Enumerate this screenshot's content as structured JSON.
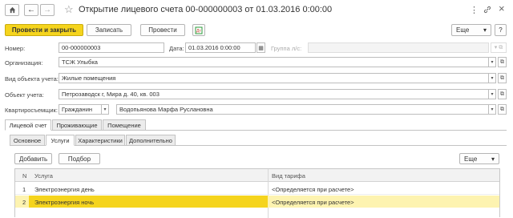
{
  "window": {
    "title": "Открытие лицевого счета 00-000000003 от 01.03.2016 0:00:00",
    "star": "☆",
    "more_icon": "⋮",
    "link_icon": "🔗",
    "close_icon": "×"
  },
  "toolbar": {
    "post_close_label": "Провести и закрыть",
    "save_label": "Записать",
    "post_label": "Провести",
    "more_label": "Еще",
    "help_label": "?",
    "dropdown_icon": "▾",
    "print_icon": "Дт"
  },
  "form": {
    "number_label": "Номер:",
    "number_value": "00-000000003",
    "date_label": "Дата:",
    "date_value": "01.03.2016  0:00:00",
    "group_label": "Группа л/с:",
    "org_label": "Организация:",
    "org_value": "ТСЖ Улыбка",
    "object_kind_label": "Вид объекта учета:",
    "object_kind_value": "Жилые помещения",
    "object_label": "Объект учета:",
    "object_value": "Петрозаводск г, Мира д. 40, кв. 003",
    "tenant_label": "Квартиросъемщик:",
    "tenant_type_value": "Гражданин",
    "tenant_value": "Водопьянова Марфа Руслановна"
  },
  "outer_tabs": [
    "Лицевой счет",
    "Проживающие",
    "Помещение"
  ],
  "inner_tabs": [
    "Основное",
    "Услуги",
    "Характеристики",
    "Дополнительно"
  ],
  "services": {
    "add_label": "Добавить",
    "pick_label": "Подбор",
    "more_label": "Еще",
    "columns": {
      "n": "N",
      "service": "Услуга",
      "tariff": "Вид тарифа"
    },
    "rows": [
      {
        "n": "1",
        "service": "Электроэнергия день",
        "tariff": "<Определяется при расчете>"
      },
      {
        "n": "2",
        "service": "Электроэнергия ночь",
        "tariff": "<Определяется при расчете>"
      }
    ]
  },
  "colors": {
    "accent": "#f5d41d",
    "row_highlight": "#fdf3b0",
    "header_bg": "#f2f2f2"
  }
}
